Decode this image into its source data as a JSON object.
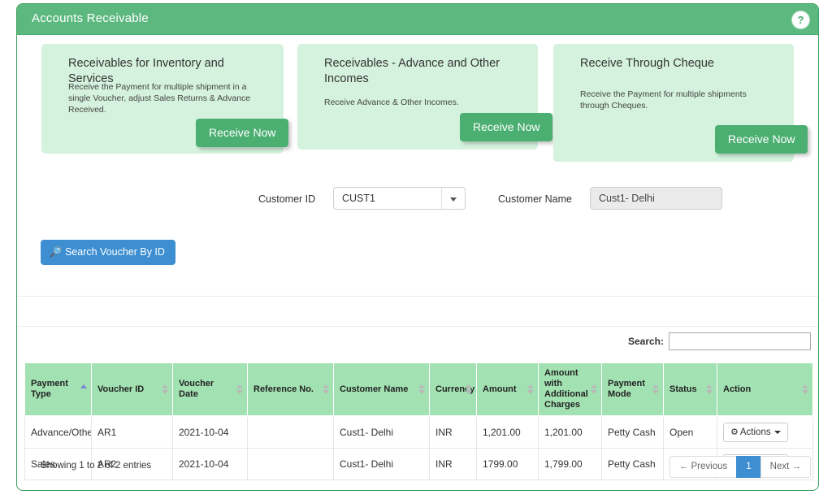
{
  "header": {
    "title": "Accounts Receivable",
    "help_icon": "question-mark-icon",
    "help_label": "?",
    "bar_color": "#5cb87f"
  },
  "cards": [
    {
      "title": "Receivables for Inventory and Services",
      "description": "Receive the Payment for multiple shipment in a single Voucher, adjust Sales Returns & Advance Received.",
      "button_label": "Receive Now"
    },
    {
      "title": "Receivables - Advance and Other Incomes",
      "description": "Receive Advance & Other Incomes.",
      "button_label": "Receive Now"
    },
    {
      "title": "Receive Through Cheque",
      "description": "Receive the Payment for multiple shipments through Cheques.",
      "button_label": "Receive Now"
    }
  ],
  "filters": {
    "customer_id_label": "Customer ID",
    "customer_id_value": "CUST1",
    "customer_name_label": "Customer Name",
    "customer_name_value": "Cust1- Delhi",
    "search_voucher_button": "Search Voucher By ID",
    "search_voucher_icon": "magnifier-icon"
  },
  "table": {
    "search_label": "Search:",
    "search_value": "",
    "search_placeholder": "",
    "columns": [
      {
        "label": "Payment Type",
        "sort": "asc"
      },
      {
        "label": "Voucher ID",
        "sort": "none"
      },
      {
        "label": "Voucher Date",
        "sort": "none"
      },
      {
        "label": "Reference No.",
        "sort": "none"
      },
      {
        "label": "Customer Name",
        "sort": "none"
      },
      {
        "label": "Currency",
        "sort": "none"
      },
      {
        "label": "Amount",
        "sort": "none"
      },
      {
        "label": "Amount with Additional Charges",
        "sort": "none"
      },
      {
        "label": "Payment Mode",
        "sort": "none"
      },
      {
        "label": "Status",
        "sort": "none"
      },
      {
        "label": "Action",
        "sort": "none"
      }
    ],
    "rows": [
      {
        "payment_type": "Advance/Others",
        "voucher_id": "AR1",
        "voucher_date": "2021-10-04",
        "reference_no": "",
        "customer_name": "Cust1- Delhi",
        "currency": "INR",
        "amount": "1,201.00",
        "amount_with_charges": "1,201.00",
        "payment_mode": "Petty Cash",
        "status": "Open",
        "action_label": "Actions",
        "action_icon": "gear-icon"
      },
      {
        "payment_type": "Sales",
        "voucher_id": "AR2",
        "voucher_date": "2021-10-04",
        "reference_no": "",
        "customer_name": "Cust1- Delhi",
        "currency": "INR",
        "amount": "1799.00",
        "amount_with_charges": "1,799.00",
        "payment_mode": "Petty Cash",
        "status": "Open",
        "action_label": "Actions",
        "action_icon": "gear-icon"
      }
    ],
    "entries_info": "Showing 1 to 2 of 2 entries",
    "pagination": {
      "previous": "← Previous",
      "pages": [
        "1"
      ],
      "next": "Next →",
      "active_page": "1"
    }
  },
  "colors": {
    "header_green": "#5cb87f",
    "card_green": "#d4f2dd",
    "button_green": "#4caf72",
    "table_header_green": "#a2e2b2",
    "accent_blue": "#3d8fd1",
    "link_blue": "#4a90d9"
  }
}
